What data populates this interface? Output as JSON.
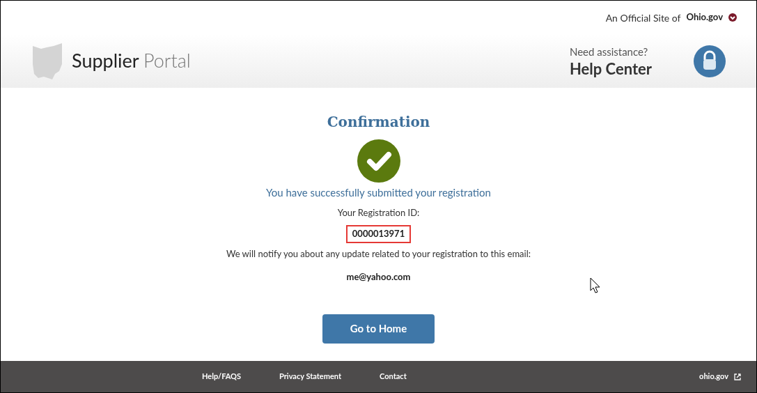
{
  "top_bar": {
    "official_text": "An Official Site of",
    "ohio_logo": "Ohio.gov"
  },
  "header": {
    "brand_bold": "Supplier",
    "brand_light": "Portal",
    "help_prompt": "Need assistance?",
    "help_link": "Help Center"
  },
  "confirmation": {
    "title": "Confirmation",
    "success_message": "You have successfully submitted your registration",
    "id_label": "Your Registration ID:",
    "registration_id": "0000013971",
    "notify_text": "We will notify you about any update related to your registration to this email:",
    "email": "me@yahoo.com",
    "button": "Go to Home"
  },
  "footer": {
    "links": [
      "Help/FAQS",
      "Privacy Statement",
      "Contact"
    ],
    "external_link": "ohio.gov"
  }
}
